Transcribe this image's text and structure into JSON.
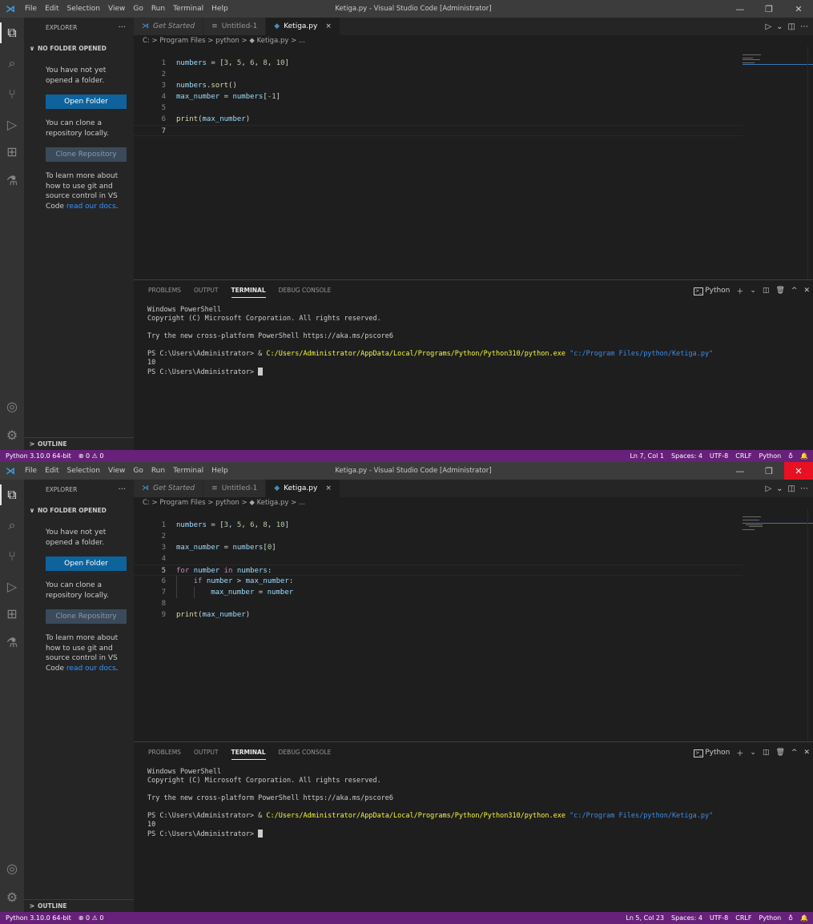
{
  "windows": [
    {
      "title": "Ketiga.py - Visual Studio Code [Administrator]",
      "close_hover": false,
      "menu": [
        "File",
        "Edit",
        "Selection",
        "View",
        "Go",
        "Run",
        "Terminal",
        "Help"
      ],
      "sidebar": {
        "title": "EXPLORER",
        "more": "···",
        "section": "NO FOLDER OPENED",
        "text1": "You have not yet opened a folder.",
        "open_folder": "Open Folder",
        "text2": "You can clone a repository locally.",
        "clone_repo": "Clone Repository",
        "text3": "To learn more about how to use git and source control in VS Code ",
        "docs_link": "read our docs",
        "text3_end": ".",
        "outline": "OUTLINE"
      },
      "tabs": [
        {
          "label": "Get Started",
          "icon": "vscode-icon"
        },
        {
          "label": "Untitled-1",
          "icon": "lines-icon"
        },
        {
          "label": "Ketiga.py",
          "icon": "python-icon",
          "close": "×"
        }
      ],
      "breadcrumb": "C: > Program Files > python > ◆ Ketiga.py > ...",
      "current_line": 7,
      "code": [
        {
          "n": "1",
          "code": "numbers = [3, 5, 6, 8, 10]"
        },
        {
          "n": "2",
          "code": ""
        },
        {
          "n": "3",
          "code": "numbers.sort()"
        },
        {
          "n": "4",
          "code": "max_number = numbers[-1]"
        },
        {
          "n": "5",
          "code": ""
        },
        {
          "n": "6",
          "code": "print(max_number)"
        },
        {
          "n": "7",
          "code": ""
        }
      ],
      "panel_tabs": [
        "PROBLEMS",
        "OUTPUT",
        "TERMINAL",
        "DEBUG CONSOLE"
      ],
      "panel_shell": "Python",
      "terminal": {
        "l1": "Windows PowerShell",
        "l2": "Copyright (C) Microsoft Corporation. All rights reserved.",
        "l3": "Try the new cross-platform PowerShell https://aka.ms/pscore6",
        "prompt": "PS C:\\Users\\Administrator> & ",
        "cmd": "C:/Users/Administrator/AppData/Local/Programs/Python/Python310/python.exe",
        "arg": " \"c:/Program Files/python/Ketiga.py\"",
        "output": "10",
        "prompt2": "PS C:\\Users\\Administrator> "
      },
      "status": {
        "interpreter": "Python 3.10.0 64-bit",
        "problems": "⊗ 0 ⚠ 0",
        "position": "Ln 7, Col 1",
        "spaces": "Spaces: 4",
        "encoding": "UTF-8",
        "eol": "CRLF",
        "language": "Python"
      }
    },
    {
      "title": "Ketiga.py - Visual Studio Code [Administrator]",
      "close_hover": true,
      "menu": [
        "File",
        "Edit",
        "Selection",
        "View",
        "Go",
        "Run",
        "Terminal",
        "Help"
      ],
      "sidebar": {
        "title": "EXPLORER",
        "more": "···",
        "section": "NO FOLDER OPENED",
        "text1": "You have not yet opened a folder.",
        "open_folder": "Open Folder",
        "text2": "You can clone a repository locally.",
        "clone_repo": "Clone Repository",
        "text3": "To learn more about how to use git and source control in VS Code ",
        "docs_link": "read our docs",
        "text3_end": ".",
        "outline": "OUTLINE"
      },
      "tabs": [
        {
          "label": "Get Started",
          "icon": "vscode-icon"
        },
        {
          "label": "Untitled-1",
          "icon": "lines-icon"
        },
        {
          "label": "Ketiga.py",
          "icon": "python-icon",
          "close": "×"
        }
      ],
      "breadcrumb": "C: > Program Files > python > ◆ Ketiga.py > ...",
      "current_line": 5,
      "code": [
        {
          "n": "1",
          "code": "numbers = [3, 5, 6, 8, 10]"
        },
        {
          "n": "2",
          "code": ""
        },
        {
          "n": "3",
          "code": "max_number = numbers[0]"
        },
        {
          "n": "4",
          "code": ""
        },
        {
          "n": "5",
          "code": "for number in numbers:"
        },
        {
          "n": "6",
          "code": "    if number > max_number:"
        },
        {
          "n": "7",
          "code": "        max_number = number"
        },
        {
          "n": "8",
          "code": ""
        },
        {
          "n": "9",
          "code": "print(max_number)"
        }
      ],
      "panel_tabs": [
        "PROBLEMS",
        "OUTPUT",
        "TERMINAL",
        "DEBUG CONSOLE"
      ],
      "panel_shell": "Python",
      "terminal": {
        "l1": "Windows PowerShell",
        "l2": "Copyright (C) Microsoft Corporation. All rights reserved.",
        "l3": "Try the new cross-platform PowerShell https://aka.ms/pscore6",
        "prompt": "PS C:\\Users\\Administrator> & ",
        "cmd": "C:/Users/Administrator/AppData/Local/Programs/Python/Python310/python.exe",
        "arg": " \"c:/Program Files/python/Ketiga.py\"",
        "output": "10",
        "prompt2": "PS C:\\Users\\Administrator> "
      },
      "status": {
        "interpreter": "Python 3.10.0 64-bit",
        "problems": "⊗ 0 ⚠ 0",
        "position": "Ln 5, Col 23",
        "spaces": "Spaces: 4",
        "encoding": "UTF-8",
        "eol": "CRLF",
        "language": "Python"
      }
    }
  ]
}
